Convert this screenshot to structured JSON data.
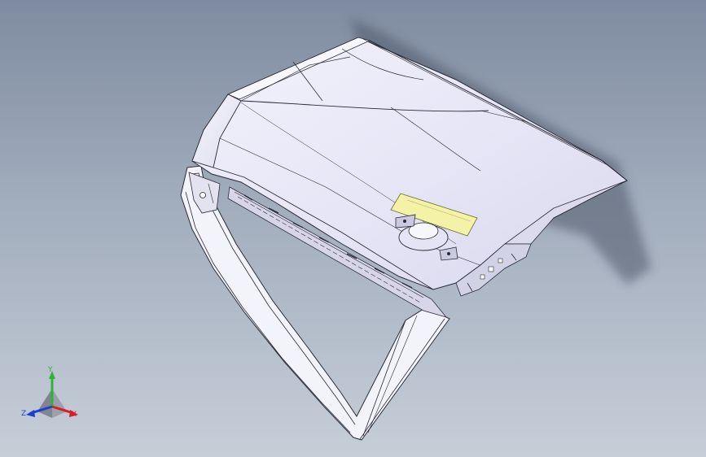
{
  "viewport": {
    "background_top": "#7f8ba0",
    "background_bottom": "#c6ced8"
  },
  "model": {
    "panel_color": "#e9e9f8",
    "edge_color": "#2b2b36",
    "highlight_color": "#f4f2a6",
    "shadow_color": "#5f6878"
  },
  "triad": {
    "x_label": "X",
    "y_label": "Y",
    "z_label": "Z",
    "x_color": "#d42020",
    "y_color": "#2fb23a",
    "z_color": "#1d3fd1"
  }
}
